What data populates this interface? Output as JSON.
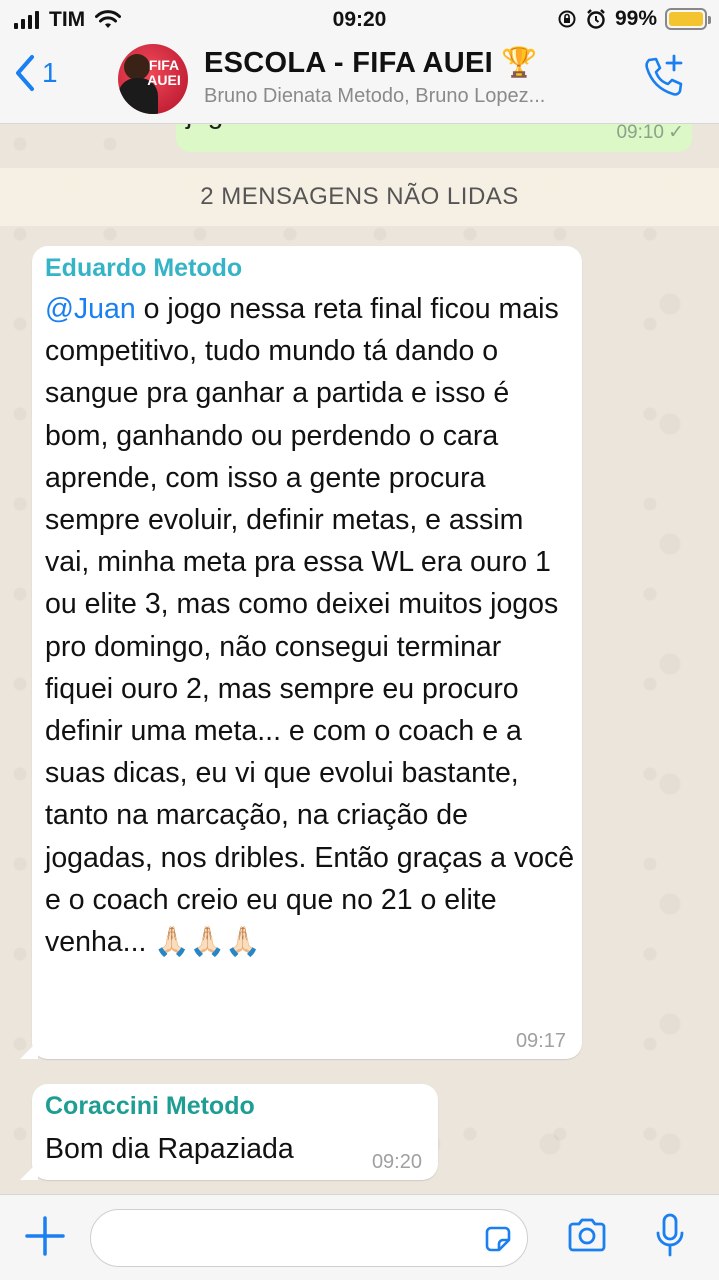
{
  "status_bar": {
    "carrier": "TIM",
    "time": "09:20",
    "battery_percent": "99%",
    "battery_level": 0.99
  },
  "header": {
    "back_count": "1",
    "title": "ESCOLA - FIFA AUEI",
    "title_emoji": "🏆",
    "subtitle": "Bruno Dienata Metodo, Bruno Lopez...",
    "avatar_text": "FIFA AUEI",
    "icons": [
      "chevron-left-icon",
      "add-call-icon"
    ]
  },
  "previous_message": {
    "text": "jogar",
    "time": "09:10",
    "status": "✓"
  },
  "unread_banner": "2 MENSAGENS NÃO LIDAS",
  "messages": [
    {
      "sender": "Eduardo Metodo",
      "sender_color": "#35b3c7",
      "mention": "@Juan",
      "text": " o jogo nessa reta final ficou mais competitivo, tudo mundo tá dando o sangue pra ganhar a partida e isso é bom, ganhando ou perdendo o cara aprende, com isso a gente procura sempre evoluir, definir metas, e assim vai, minha meta pra essa WL era ouro 1 ou elite 3, mas como deixei muitos jogos pro domingo, não consegui terminar fiquei ouro 2, mas sempre eu procuro definir uma meta... e com o coach e a suas dicas, eu vi que evolui bastante, tanto na marcação, na criação de jogadas, nos dribles. Então graças a você e o coach creio eu que no 21 o elite venha... 🙏🏻🙏🏻🙏🏻",
      "time": "09:17"
    },
    {
      "sender": "Coraccini Metodo",
      "sender_color": "#1e9e92",
      "text": "Bom dia Rapaziada",
      "time": "09:20"
    }
  ],
  "input_bar": {
    "placeholder": "",
    "icons": [
      "plus-icon",
      "sticker-icon",
      "camera-icon",
      "mic-icon"
    ]
  },
  "colors": {
    "accent": "#1a7ff0",
    "outgoing_bubble": "#dcf8c6",
    "incoming_bubble": "#ffffff",
    "battery": "#f4c430"
  }
}
